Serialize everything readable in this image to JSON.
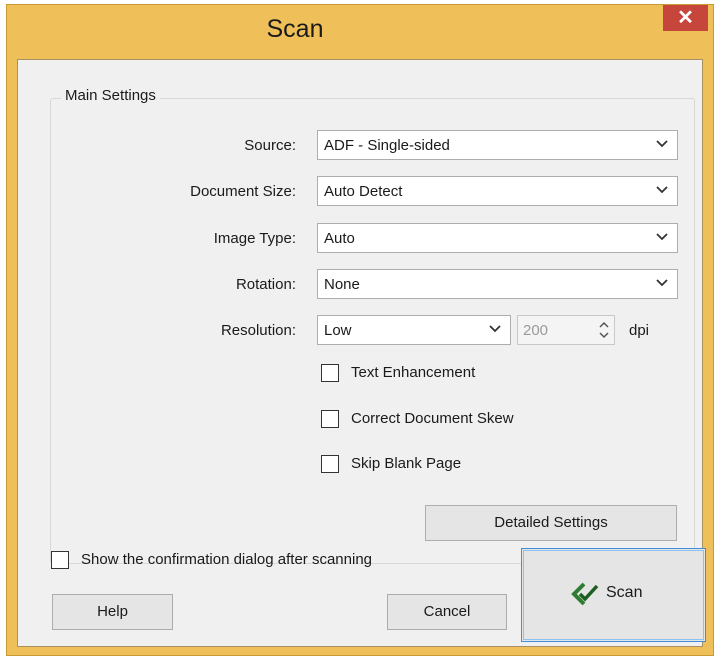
{
  "window": {
    "title": "Scan",
    "close_glyph": "✕"
  },
  "main_settings": {
    "group_label": "Main Settings",
    "source": {
      "label": "Source:",
      "value": "ADF - Single-sided"
    },
    "document_size": {
      "label": "Document Size:",
      "value": "Auto Detect"
    },
    "image_type": {
      "label": "Image Type:",
      "value": "Auto"
    },
    "rotation": {
      "label": "Rotation:",
      "value": "None"
    },
    "resolution": {
      "label": "Resolution:",
      "value": "Low",
      "dpi_value": "200",
      "unit": "dpi"
    },
    "checkboxes": [
      {
        "label": "Text Enhancement",
        "checked": false
      },
      {
        "label": "Correct Document Skew",
        "checked": false
      },
      {
        "label": "Skip Blank Page",
        "checked": false
      }
    ],
    "detailed_settings_label": "Detailed Settings"
  },
  "footer": {
    "confirmation": {
      "label": "Show the confirmation dialog after scanning",
      "checked": false
    },
    "help_label": "Help",
    "cancel_label": "Cancel",
    "scan_label": "Scan"
  },
  "icons": {
    "close": "close-icon",
    "chevron": "chevron-down-icon",
    "spinner": "spinner-arrows-icon",
    "scan": "scan-icon"
  },
  "colors": {
    "title_bar": "#efc05a",
    "close_button": "#c7463b",
    "focus_border": "#3c8fdd"
  }
}
